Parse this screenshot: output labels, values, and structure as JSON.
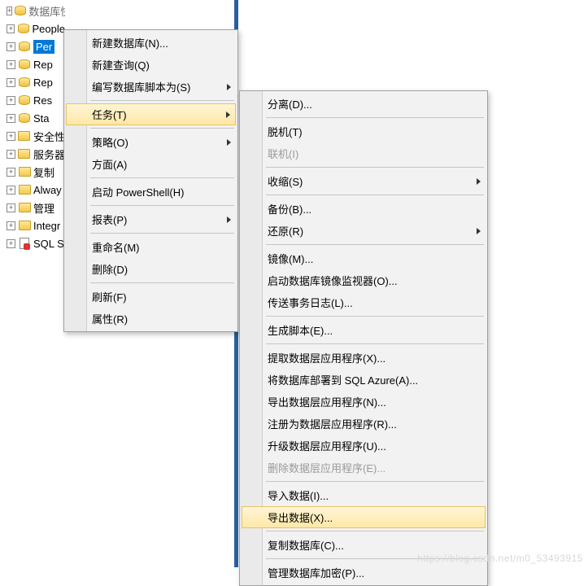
{
  "tree": {
    "items": [
      {
        "label": "数据库快照",
        "icon": "db",
        "top": true
      },
      {
        "label": "People",
        "icon": "db"
      },
      {
        "label": "Per",
        "icon": "db",
        "selected": true
      },
      {
        "label": "Rep",
        "icon": "db"
      },
      {
        "label": "Rep",
        "icon": "db"
      },
      {
        "label": "Res",
        "icon": "db"
      },
      {
        "label": "Sta",
        "icon": "db"
      },
      {
        "label": "安全性",
        "icon": "folder"
      },
      {
        "label": "服务器",
        "icon": "folder"
      },
      {
        "label": "复制",
        "icon": "folder"
      },
      {
        "label": "Alway",
        "icon": "folder"
      },
      {
        "label": "管理",
        "icon": "folder"
      },
      {
        "label": "Integr",
        "icon": "folder"
      },
      {
        "label": "SQL S",
        "icon": "script"
      }
    ]
  },
  "menu1": {
    "items": [
      {
        "label": "新建数据库(N)..."
      },
      {
        "label": "新建查询(Q)"
      },
      {
        "label": "编写数据库脚本为(S)",
        "submenu": true
      },
      {
        "sep": true
      },
      {
        "label": "任务(T)",
        "submenu": true,
        "hover": true
      },
      {
        "sep": true
      },
      {
        "label": "策略(O)",
        "submenu": true
      },
      {
        "label": "方面(A)"
      },
      {
        "sep": true
      },
      {
        "label": "启动 PowerShell(H)"
      },
      {
        "sep": true
      },
      {
        "label": "报表(P)",
        "submenu": true
      },
      {
        "sep": true
      },
      {
        "label": "重命名(M)"
      },
      {
        "label": "删除(D)"
      },
      {
        "sep": true
      },
      {
        "label": "刷新(F)"
      },
      {
        "label": "属性(R)"
      }
    ]
  },
  "menu2": {
    "items": [
      {
        "label": "分离(D)..."
      },
      {
        "sep": true
      },
      {
        "label": "脱机(T)"
      },
      {
        "label": "联机(I)",
        "disabled": true
      },
      {
        "sep": true
      },
      {
        "label": "收缩(S)",
        "submenu": true
      },
      {
        "sep": true
      },
      {
        "label": "备份(B)..."
      },
      {
        "label": "还原(R)",
        "submenu": true
      },
      {
        "sep": true
      },
      {
        "label": "镜像(M)..."
      },
      {
        "label": "启动数据库镜像监视器(O)..."
      },
      {
        "label": "传送事务日志(L)..."
      },
      {
        "sep": true
      },
      {
        "label": "生成脚本(E)..."
      },
      {
        "sep": true
      },
      {
        "label": "提取数据层应用程序(X)..."
      },
      {
        "label": "将数据库部署到 SQL Azure(A)..."
      },
      {
        "label": "导出数据层应用程序(N)..."
      },
      {
        "label": "注册为数据层应用程序(R)..."
      },
      {
        "label": "升级数据层应用程序(U)..."
      },
      {
        "label": "删除数据层应用程序(E)...",
        "disabled": true
      },
      {
        "sep": true
      },
      {
        "label": "导入数据(I)..."
      },
      {
        "label": "导出数据(X)...",
        "hover": true
      },
      {
        "sep": true
      },
      {
        "label": "复制数据库(C)..."
      },
      {
        "sep": true
      },
      {
        "label": "管理数据库加密(P)..."
      }
    ]
  },
  "watermark": "https://blog.csdn.net/m0_53493915"
}
